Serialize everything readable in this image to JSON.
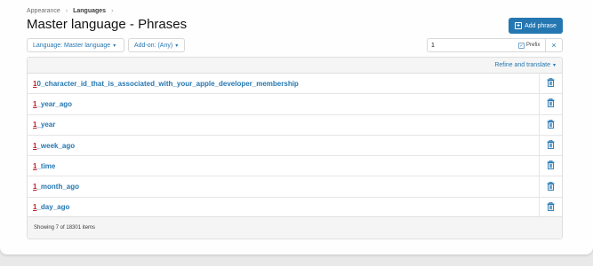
{
  "breadcrumb": {
    "items": [
      "Appearance",
      "Languages"
    ],
    "separator": "›"
  },
  "page_title": "Master language - Phrases",
  "add_phrase_label": "Add phrase",
  "filters": {
    "language_label": "Language: Master language",
    "addon_label": "Add-on: (Any)",
    "search_value": "1",
    "prefix_label": "Prefix",
    "clear_symbol": "×"
  },
  "block_header": {
    "refine_label": "Refine and translate"
  },
  "phrases": [
    {
      "highlight": "1",
      "rest": "0_character_id_that_is_associated_with_your_apple_developer_membership"
    },
    {
      "highlight": "1",
      "rest": "_year_ago"
    },
    {
      "highlight": "1",
      "rest": "_year"
    },
    {
      "highlight": "1",
      "rest": "_week_ago"
    },
    {
      "highlight": "1",
      "rest": "_time"
    },
    {
      "highlight": "1",
      "rest": "_month_ago"
    },
    {
      "highlight": "1",
      "rest": "_day_ago"
    }
  ],
  "footer_text": "Showing 7 of 18301 items",
  "colors": {
    "accent": "#2577b1",
    "highlight": "#c0202a"
  },
  "icons": {
    "delete": "trash-icon",
    "add": "plus-icon",
    "caret": "caret-down-icon"
  }
}
